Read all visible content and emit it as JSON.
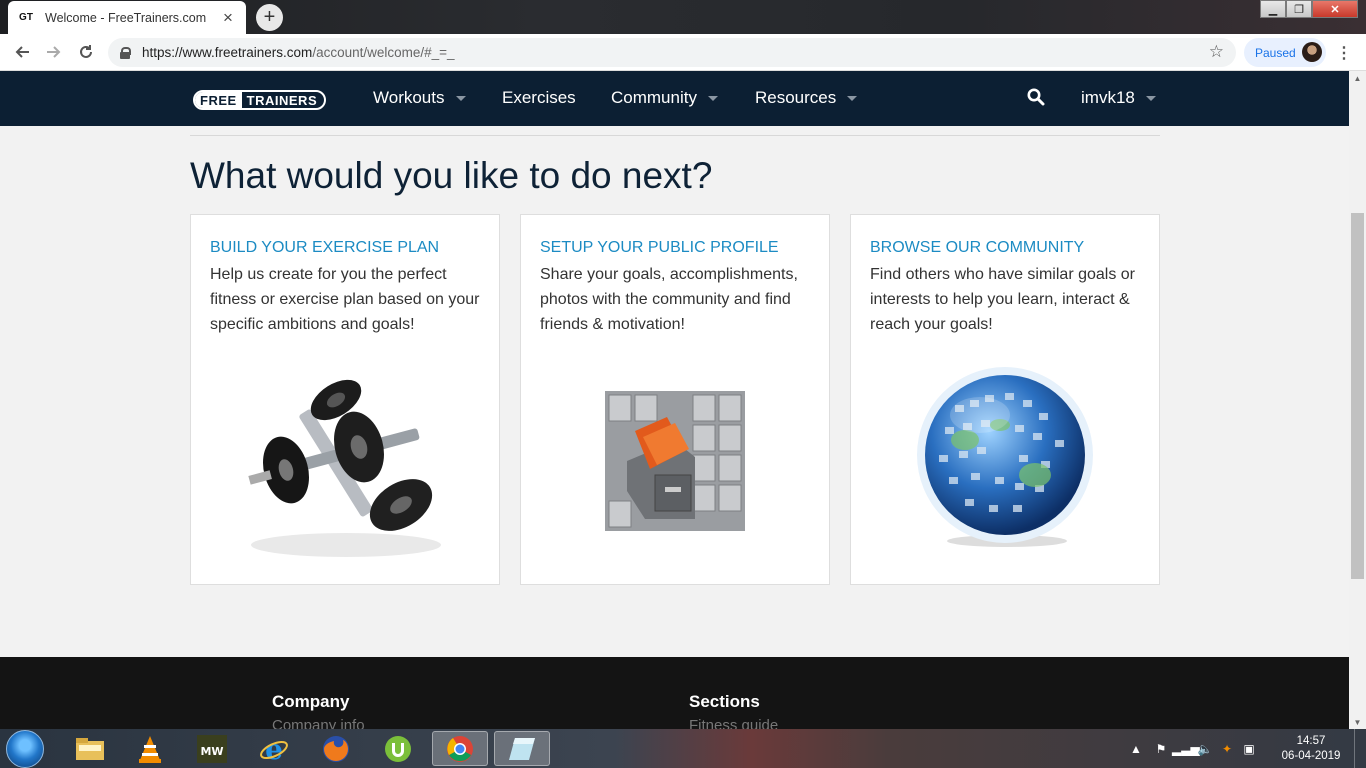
{
  "browser": {
    "tab_title": "Welcome - FreeTrainers.com",
    "favicon_text": "GT",
    "url_host": "https://www.freetrainers.com",
    "url_path": "/account/welcome/#_=_",
    "profile_status": "Paused"
  },
  "site": {
    "logo_free": "FREE",
    "logo_trainers": "TRAINERS",
    "nav": [
      {
        "label": "Workouts",
        "has_dropdown": true
      },
      {
        "label": "Exercises",
        "has_dropdown": false
      },
      {
        "label": "Community",
        "has_dropdown": true
      },
      {
        "label": "Resources",
        "has_dropdown": true
      }
    ],
    "username": "imvk18",
    "nav_bg": "#0c1f33",
    "accent": "#1c8bc3"
  },
  "main": {
    "heading": "What would you like to do next?",
    "cards": [
      {
        "title": "BUILD YOUR EXERCISE PLAN",
        "text": "Help us create for you the perfect fitness or exercise plan based on your specific ambitions and goals!",
        "image": "dumbbells-image"
      },
      {
        "title": "SETUP YOUR PUBLIC PROFILE",
        "text": "Share your goals, accomplishments, photos with the community and find friends & motivation!",
        "image": "filing-cabinet-image"
      },
      {
        "title": "BROWSE OUR COMMUNITY",
        "text": "Find others who have similar goals or interests to help you learn, interact & reach your goals!",
        "image": "photo-globe-image"
      }
    ]
  },
  "footer": {
    "columns": [
      {
        "heading": "Company",
        "first_link": "Company info"
      },
      {
        "heading": "Sections",
        "first_link": "Fitness guide"
      }
    ]
  },
  "taskbar": {
    "time": "14:57",
    "date": "06-04-2019",
    "apps": [
      "windows-explorer",
      "vlc",
      "need-for-speed-most-wanted",
      "internet-explorer",
      "firefox",
      "utorrent",
      "chrome",
      "other-app"
    ]
  }
}
